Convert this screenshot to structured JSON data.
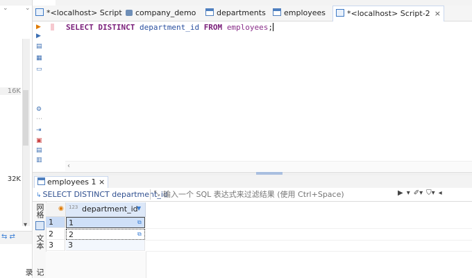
{
  "left_panel": {
    "number_1": "16K",
    "number_2": "32K"
  },
  "tabs": [
    {
      "label": "*<localhost> Script",
      "icon": "script-icon"
    },
    {
      "label": "company_demo",
      "icon": "database-icon"
    },
    {
      "label": "departments",
      "icon": "table-icon"
    },
    {
      "label": "employees",
      "icon": "table-icon"
    },
    {
      "label": "*<localhost> Script-2",
      "icon": "script-icon",
      "active": true,
      "close": "×"
    }
  ],
  "editor": {
    "sql": {
      "kw1": "SELECT DISTINCT",
      "column": "department_id",
      "kw2": "FROM",
      "table": "employees",
      "end": ";"
    }
  },
  "results": {
    "tab_label": "employees 1",
    "tab_close": "×",
    "filter_query": "SELECT DISTINCT department_id",
    "filter_placeholder": "输入一个 SQL 表达式来过滤结果 (使用 Ctrl+Space)",
    "vertical_tabs": {
      "grid": "网格",
      "text": "文本",
      "record": "记录"
    },
    "column": {
      "badge": "123",
      "name": "department_id"
    },
    "rows": [
      {
        "num": "1",
        "value": "1"
      },
      {
        "num": "2",
        "value": "2"
      },
      {
        "num": "3",
        "value": "3"
      }
    ]
  },
  "colors": {
    "accent": "#3b7fd6",
    "selected_row": "#cfe0f8",
    "keyword": "#7a1f7a"
  }
}
